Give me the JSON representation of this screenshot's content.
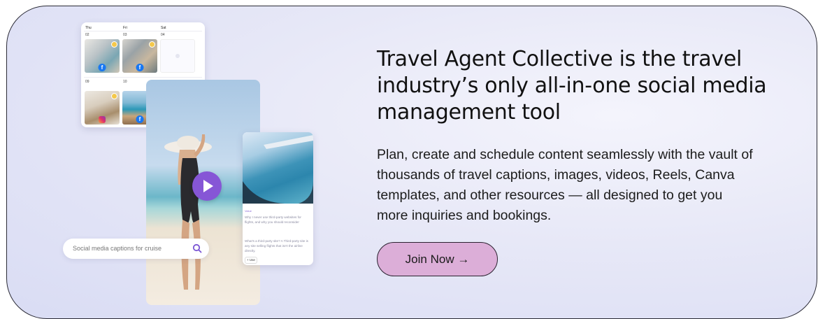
{
  "calendar": {
    "days": [
      "Thu",
      "Fri",
      "Sat"
    ],
    "week1_dates": [
      "02",
      "03",
      "04"
    ],
    "week2_dates": [
      "09",
      "10",
      "11"
    ]
  },
  "search": {
    "placeholder": "Social media captions for cruise"
  },
  "article": {
    "tag": "Value",
    "title": "Why I never use third-party websites for flights, and why you should reconsider",
    "body": "What's a third-party site? A Third-party site is any site selling flights that isn't the airline directly.",
    "use_label": "+ Use"
  },
  "headline": "Travel Agent Collective is the travel industry’s only all-in-one social media management tool",
  "description": "Plan, create and schedule content seamlessly with the vault of thousands of travel captions, images, videos, Reels, Canva templates, and other resources — all designed to get you more inquiries and bookings.",
  "cta": {
    "label": "Join Now →"
  },
  "colors": {
    "accent_purple": "#8656d6",
    "cta_pink": "#dcaed8",
    "facebook_blue": "#1877f2",
    "status_yellow": "#f4c84a"
  },
  "icons": [
    "facebook-icon",
    "instagram-icon",
    "play-icon",
    "search-icon"
  ]
}
